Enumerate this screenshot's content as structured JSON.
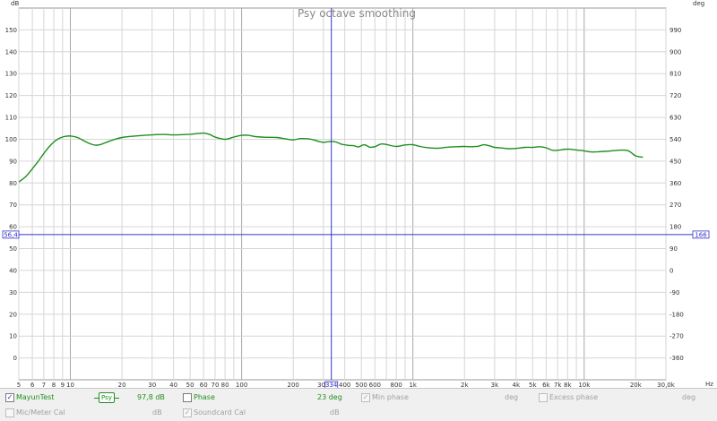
{
  "chart_data": {
    "type": "line",
    "title": "Psy octave smoothing",
    "left_unit": "dB",
    "right_unit": "deg",
    "x_unit": "Hz",
    "xscale": "log",
    "xlim": [
      5,
      30000
    ],
    "ylim_left": [
      -10,
      160
    ],
    "ylim_right": [
      -450,
      1080
    ],
    "y_left_ticks": [
      0,
      10,
      20,
      30,
      40,
      50,
      60,
      70,
      80,
      90,
      100,
      110,
      120,
      130,
      140,
      150
    ],
    "y_left_tick_labels": [
      "0",
      "10",
      "20",
      "30",
      "40",
      "50",
      "60",
      "70",
      "80",
      "90",
      "100",
      "110",
      "120",
      "130",
      "140",
      "150"
    ],
    "y_right_ticks": [
      -360,
      -270,
      -180,
      -90,
      0,
      90,
      180,
      270,
      360,
      450,
      540,
      630,
      720,
      810,
      900,
      990
    ],
    "y_right_tick_labels": [
      "-360",
      "-270",
      "-180",
      "-90",
      "0",
      "90",
      "180",
      "270",
      "360",
      "450",
      "540",
      "630",
      "720",
      "810",
      "900",
      "990"
    ],
    "x_major_ticks": [
      10,
      100,
      1000,
      10000
    ],
    "x_tick_values": [
      5,
      6,
      7,
      8,
      9,
      10,
      20,
      30,
      40,
      50,
      60,
      70,
      80,
      100,
      200,
      300,
      400,
      500,
      600,
      800,
      1000,
      2000,
      3000,
      4000,
      5000,
      6000,
      7000,
      8000,
      10000,
      20000,
      30000
    ],
    "x_tick_labels": [
      "5",
      "6",
      "7",
      "8",
      "9",
      "10",
      "20",
      "30",
      "40",
      "50",
      "60",
      "70",
      "80",
      "100",
      "200",
      "300",
      "400",
      "500",
      "600",
      "800",
      "1k",
      "2k",
      "3k",
      "4k",
      "5k",
      "6k",
      "7k",
      "8k",
      "10k",
      "20k",
      "30,0k"
    ],
    "grid": true,
    "cursor": {
      "x": 334,
      "y": 56.4,
      "x_label": "334",
      "y_label": "56,4",
      "right_label": "166"
    },
    "series": [
      {
        "name": "MayunTest",
        "color": "#1e8f1e",
        "x": [
          5,
          5.5,
          6,
          6.5,
          7,
          7.5,
          8,
          8.5,
          9,
          9.5,
          10,
          11,
          12,
          13,
          14,
          15,
          17,
          20,
          25,
          30,
          35,
          40,
          50,
          55,
          60,
          65,
          70,
          80,
          90,
          100,
          110,
          120,
          140,
          160,
          180,
          200,
          220,
          250,
          280,
          300,
          320,
          350,
          380,
          420,
          450,
          480,
          520,
          560,
          600,
          650,
          700,
          800,
          900,
          1000,
          1100,
          1200,
          1400,
          1600,
          1800,
          2000,
          2200,
          2400,
          2600,
          2800,
          3000,
          3300,
          3600,
          4000,
          4500,
          5000,
          5500,
          6000,
          6500,
          7000,
          8000,
          9000,
          10000,
          11000,
          12000,
          14000,
          16000,
          18000,
          20000,
          22000
        ],
        "values": [
          80.5,
          83,
          86.5,
          90,
          93.5,
          96.5,
          98.7,
          100.2,
          101.0,
          101.4,
          101.5,
          100.8,
          99.3,
          98.0,
          97.3,
          97.6,
          99.2,
          100.8,
          101.6,
          102.0,
          102.2,
          102.0,
          102.3,
          102.6,
          102.8,
          102.2,
          101.0,
          100.0,
          101.0,
          101.8,
          101.8,
          101.2,
          100.9,
          100.8,
          100.2,
          99.7,
          100.3,
          100.1,
          99.1,
          98.6,
          98.9,
          98.9,
          97.8,
          97.2,
          97.1,
          96.5,
          97.5,
          96.4,
          96.6,
          97.8,
          97.6,
          96.7,
          97.4,
          97.5,
          96.7,
          96.2,
          95.9,
          96.4,
          96.6,
          96.7,
          96.6,
          96.8,
          97.5,
          97.0,
          96.3,
          96.0,
          95.7,
          95.8,
          96.3,
          96.3,
          96.6,
          96.1,
          95.0,
          95.0,
          95.5,
          95.1,
          94.7,
          94.2,
          94.3,
          94.6,
          95.0,
          94.8,
          92.4,
          91.8
        ]
      }
    ]
  },
  "legend": {
    "row1": {
      "measurement": {
        "name": "MayunTest",
        "checked": "✓",
        "smoothing": "Psy",
        "value": "97,8 dB"
      },
      "phase": {
        "label": "Phase",
        "checked": "",
        "value": "23 deg"
      },
      "min_phase": {
        "label": "Min phase",
        "checked": "✓",
        "value": "deg"
      },
      "excess_phase": {
        "label": "Excess phase",
        "checked": "",
        "value": "deg"
      }
    },
    "row2": {
      "mic_cal": {
        "label": "Mic/Meter Cal",
        "checked": "",
        "value": "dB"
      },
      "soundcard_cal": {
        "label": "Soundcard Cal",
        "checked": "✓",
        "value": "dB"
      }
    }
  },
  "colors": {
    "curve": "#1e8f1e",
    "grid": "#d6d6d6",
    "cursor": "#3333cc"
  }
}
